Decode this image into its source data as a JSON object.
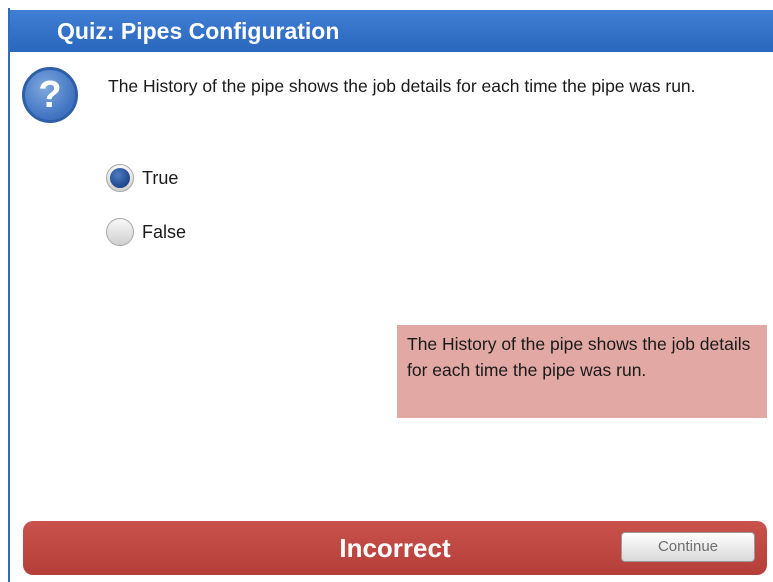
{
  "quiz": {
    "title": "Quiz: Pipes Configuration",
    "question": "The History of the pipe shows the job details for each time the pipe was run.",
    "options": [
      {
        "label": "True",
        "selected": true
      },
      {
        "label": "False",
        "selected": false
      }
    ],
    "feedback": "The History of the pipe shows the job details for each time the pipe was run.",
    "result": "Incorrect",
    "continue_label": "Continue"
  },
  "icons": {
    "question": "question-mark-icon",
    "question_glyph": "?"
  },
  "colors": {
    "header": "#2d6cc0",
    "result_bar": "#bd4742",
    "feedback_bg": "#e2a8a4",
    "selected_radio": "#1b3f82"
  }
}
